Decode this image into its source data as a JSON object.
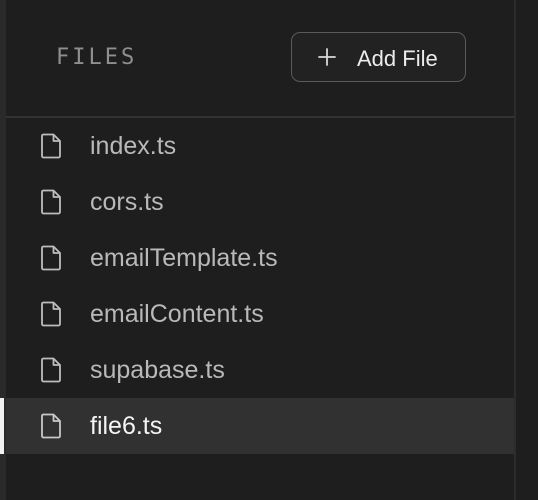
{
  "header": {
    "title": "FILES",
    "add_button_label": "Add File"
  },
  "icons": {
    "add": "plus-icon",
    "file": "file-icon"
  },
  "colors": {
    "background": "#1e1e1e",
    "active_row": "#313131",
    "active_indicator": "#f2f2f2",
    "text_muted": "#b9b9b9",
    "text_active": "#f4f4f4"
  },
  "files": [
    {
      "name": "index.ts",
      "active": false
    },
    {
      "name": "cors.ts",
      "active": false
    },
    {
      "name": "emailTemplate.ts",
      "active": false
    },
    {
      "name": "emailContent.ts",
      "active": false
    },
    {
      "name": "supabase.ts",
      "active": false
    },
    {
      "name": "file6.ts",
      "active": true
    }
  ]
}
